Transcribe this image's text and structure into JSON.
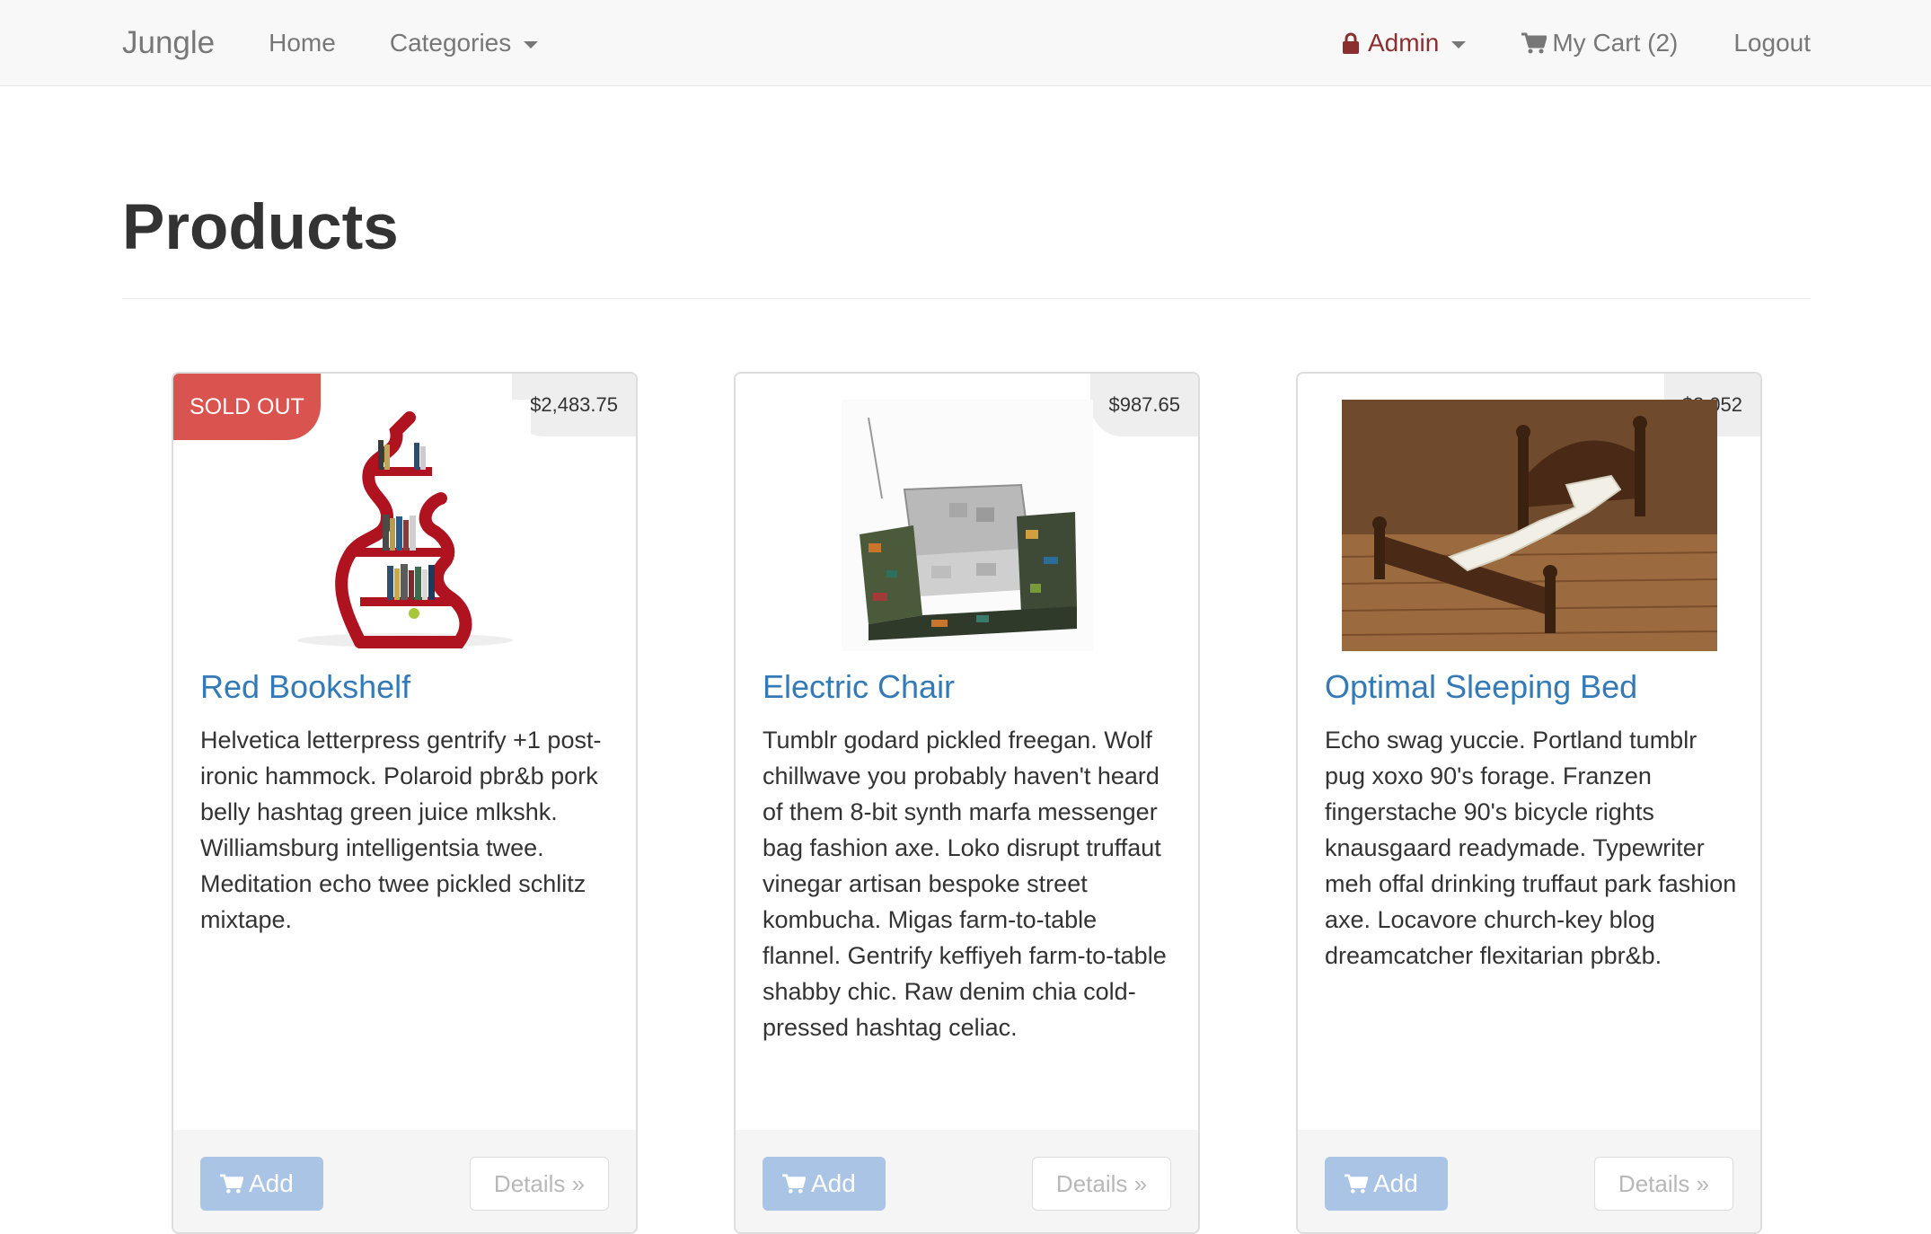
{
  "navbar": {
    "brand": "Jungle",
    "home": "Home",
    "categories": "Categories",
    "admin": "Admin",
    "cart": "My Cart (2)",
    "logout": "Logout"
  },
  "page": {
    "title": "Products"
  },
  "products": [
    {
      "name": "Red Bookshelf",
      "price": "$2,483.75",
      "badge": "SOLD OUT",
      "description": "Helvetica letterpress gentrify +1 post-ironic hammock. Polaroid pbr&b pork belly hashtag green juice mlkshk. Williamsburg intelligentsia twee. Meditation echo twee pickled schlitz mixtape.",
      "add_label": "Add",
      "details_label": "Details »"
    },
    {
      "name": "Electric Chair",
      "price": "$987.65",
      "description": "Tumblr godard pickled freegan. Wolf chillwave you probably haven't heard of them 8-bit synth marfa messenger bag fashion axe. Loko disrupt truffaut vinegar artisan bespoke street kombucha. Migas farm-to-table flannel. Gentrify keffiyeh farm-to-table shabby chic. Raw denim chia cold-pressed hashtag celiac.",
      "add_label": "Add",
      "details_label": "Details »"
    },
    {
      "name": "Optimal Sleeping Bed",
      "price": "$3,052",
      "description": "Echo swag yuccie. Portland tumblr pug xoxo 90's forage. Franzen fingerstache 90's bicycle rights knausgaard readymade. Typewriter meh offal drinking truffaut park fashion axe. Locavore church-key blog dreamcatcher flexitarian pbr&b.",
      "add_label": "Add",
      "details_label": "Details »"
    }
  ],
  "colors": {
    "navbar_bg": "#f8f8f8",
    "link": "#337ab7",
    "sold_out": "#d9534f",
    "admin": "#8b2e2e",
    "add_button": "#a9c4e4"
  },
  "icons": {
    "admin": "lock-icon",
    "cart": "shopping-cart-icon",
    "categories_dropdown": "caret-down-icon"
  }
}
